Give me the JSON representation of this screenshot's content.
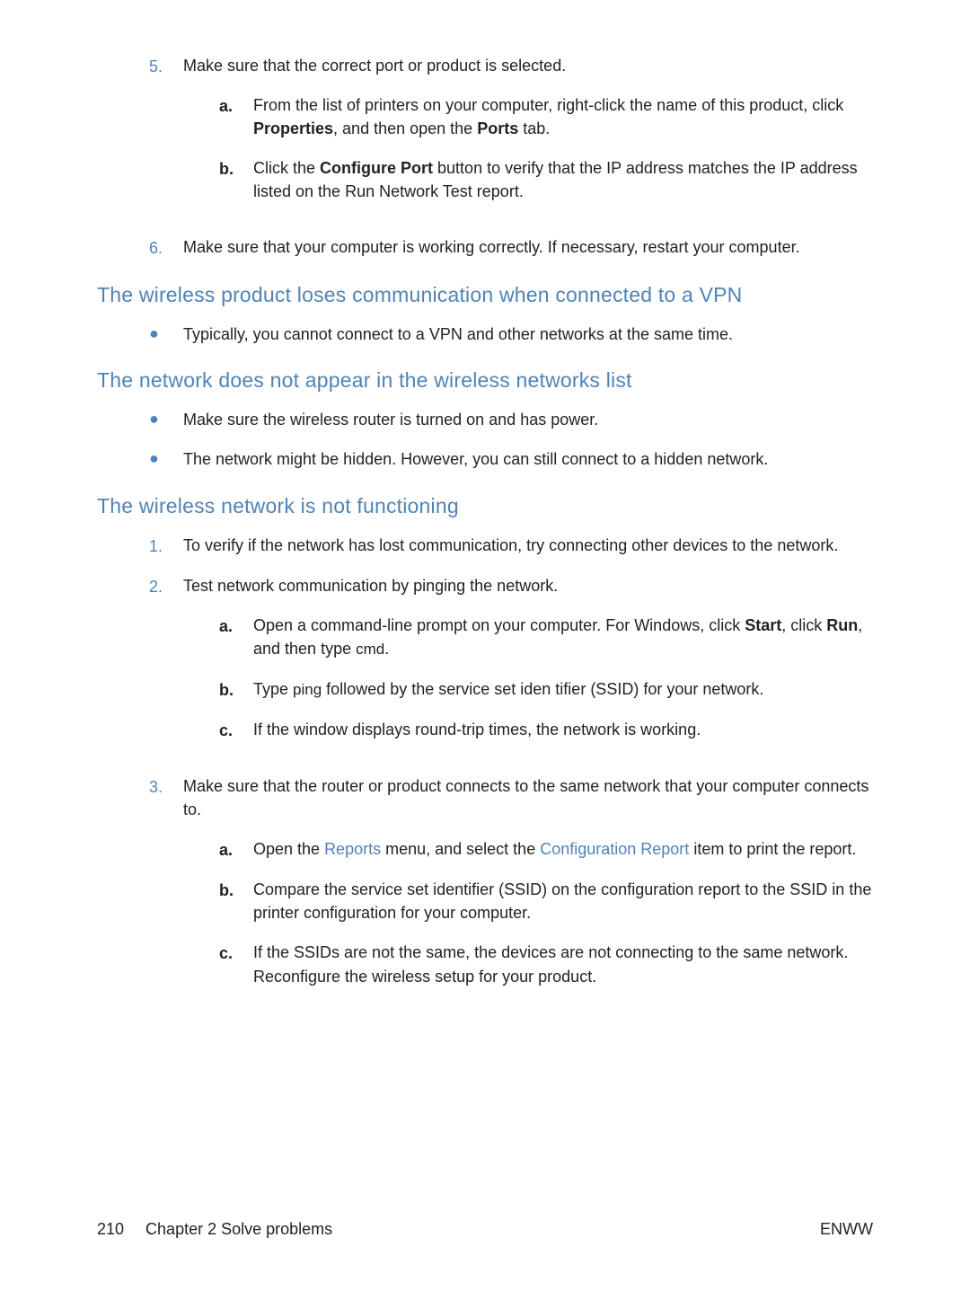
{
  "section1": {
    "item5": {
      "marker": "5.",
      "text": "Make sure that the correct port or product is selected.",
      "sub": {
        "a": {
          "marker": "a.",
          "pre": "From the list of printers on your computer, right-click the name of this product, click ",
          "bold1": "Properties",
          "mid": ", and then open the ",
          "bold2": "Ports",
          "post": " tab."
        },
        "b": {
          "marker": "b.",
          "pre": "Click the ",
          "bold1": "Configure Port",
          "post": " button to verify that the IP address matches the IP address listed on the Run Network Test report."
        }
      }
    },
    "item6": {
      "marker": "6.",
      "text": "Make sure that your computer is working correctly. If necessary, restart your computer."
    }
  },
  "heading_vpn": "The wireless product loses communication when connected to a VPN",
  "vpn_bullets": {
    "b1": {
      "marker": "●",
      "text": "Typically, you cannot connect to a VPN and other networks at the same time."
    }
  },
  "heading_list": "The network does not appear in the wireless networks list",
  "list_bullets": {
    "b1": {
      "marker": "●",
      "text": "Make sure the wireless router is turned on and has power."
    },
    "b2": {
      "marker": "●",
      "text": "The network might be hidden. However, you can still connect to a hidden network."
    }
  },
  "heading_func": "The wireless network is not functioning",
  "func": {
    "item1": {
      "marker": "1.",
      "text": "To verify if the network has lost communication, try connecting other devices to the network."
    },
    "item2": {
      "marker": "2.",
      "text": "Test network communication by pinging the network.",
      "sub": {
        "a": {
          "marker": "a.",
          "pre": "Open a command-line prompt on your computer. For Windows, click ",
          "bold1": "Start",
          "mid1": ", click ",
          "bold2": "Run",
          "mid2": ", and then type ",
          "mono": "cmd",
          "post": "."
        },
        "b": {
          "marker": "b.",
          "pre": "Type ",
          "mono": "ping",
          "post": " followed by the service set iden  tifier (SSID) for your network."
        },
        "c": {
          "marker": "c.",
          "text": "If the window displays round-trip times, the network is working."
        }
      }
    },
    "item3": {
      "marker": "3.",
      "text": "Make sure that the router or product connects to the same network that your computer connects to.",
      "sub": {
        "a": {
          "marker": "a.",
          "pre": "Open the ",
          "link1": "Reports",
          "mid": " menu, and select the ",
          "link2": "Configuration Report",
          "post": " item to print the report."
        },
        "b": {
          "marker": "b.",
          "text": "Compare the service set identifier (SSID) on the configuration report to the SSID in the printer configuration for your computer."
        },
        "c": {
          "marker": "c.",
          "text": "If the SSIDs are not the same, the devices are not connecting to the same network. Reconfigure the wireless setup for your product."
        }
      }
    }
  },
  "footer": {
    "page": "210",
    "chapter": "Chapter 2   Solve problems",
    "right": "ENWW"
  }
}
